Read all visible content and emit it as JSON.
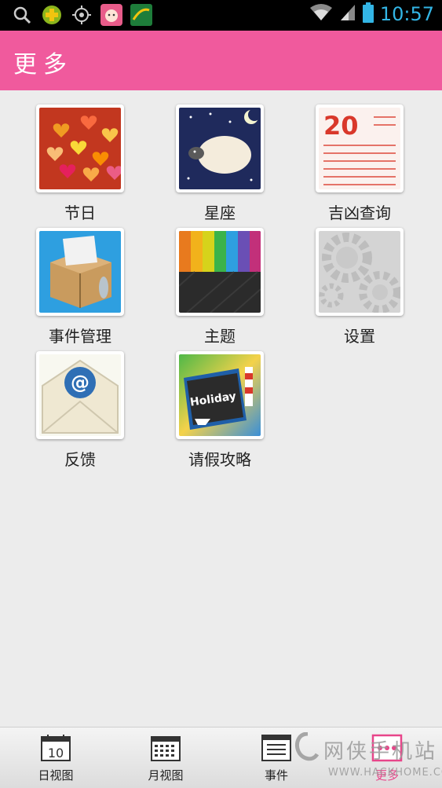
{
  "status_bar": {
    "time": "10:57",
    "icons": [
      "search-icon",
      "plus-circle-icon",
      "gps-icon",
      "app-avatar-icon",
      "app-green-icon",
      "wifi-icon",
      "signal-icon",
      "battery-icon"
    ],
    "time_color": "#33b5e5"
  },
  "header": {
    "title": "更多",
    "color": "#f05a9d"
  },
  "grid": {
    "items": [
      {
        "label": "节日",
        "icon": "hearts-bokeh-icon"
      },
      {
        "label": "星座",
        "icon": "sheep-night-icon"
      },
      {
        "label": "吉凶查询",
        "icon": "almanac-icon"
      },
      {
        "label": "事件管理",
        "icon": "box-icon"
      },
      {
        "label": "主题",
        "icon": "color-stripes-icon"
      },
      {
        "label": "设置",
        "icon": "gears-icon"
      },
      {
        "label": "反馈",
        "icon": "email-at-icon"
      },
      {
        "label": "请假攻略",
        "icon": "holiday-book-icon",
        "icon_text": "Holiday"
      }
    ],
    "almanac_number": "20"
  },
  "bottom_nav": {
    "items": [
      {
        "label": "日视图",
        "icon": "day-calendar-icon",
        "icon_text": "10"
      },
      {
        "label": "月视图",
        "icon": "month-calendar-icon"
      },
      {
        "label": "事件",
        "icon": "event-list-icon"
      },
      {
        "label": "更多",
        "icon": "more-icon",
        "active": true
      }
    ],
    "active_color": "#e8458a"
  },
  "watermark": {
    "text": "网侠手机站",
    "sub": "WWW.HACKHOME.COM"
  }
}
